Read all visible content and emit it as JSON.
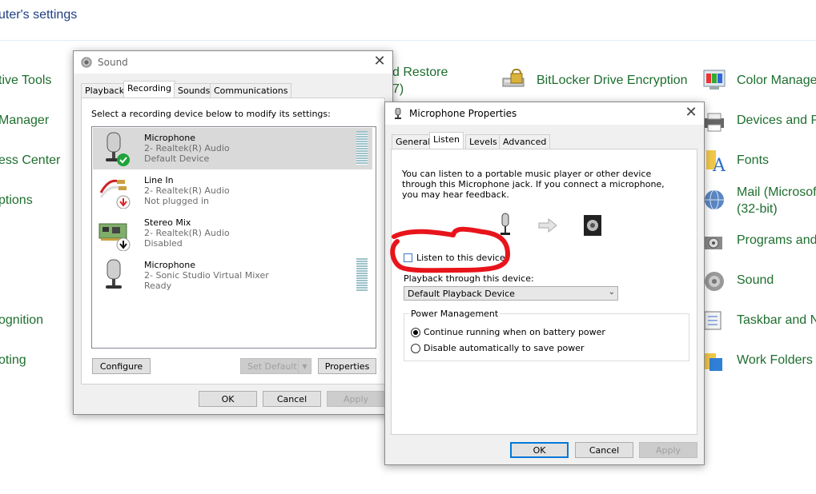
{
  "control_panel": {
    "heading": "uter's settings",
    "col1": [
      "tive Tools",
      "Manager",
      "ess Center",
      "ptions",
      "ognition",
      "oting"
    ],
    "col2": [
      "d Restore",
      "7)"
    ],
    "col3": [
      "BitLocker Drive Encryption"
    ],
    "col4": [
      "Color Manage",
      "Devices and Pr",
      "Fonts",
      "Mail (Microsof",
      "(32-bit)",
      "Programs and",
      "Sound",
      "Taskbar and N",
      "Work Folders"
    ]
  },
  "sound_dialog": {
    "title": "Sound",
    "tabs": [
      "Playback",
      "Recording",
      "Sounds",
      "Communications"
    ],
    "active_tab": "Recording",
    "instruction": "Select a recording device below to modify its settings:",
    "devices": [
      {
        "name": "Microphone",
        "driver": "2- Realtek(R) Audio",
        "status": "Default Device",
        "icon": "microphone-icon",
        "badge": "green-check"
      },
      {
        "name": "Line In",
        "driver": "2- Realtek(R) Audio",
        "status": "Not plugged in",
        "icon": "line-in-cable-icon",
        "badge": "red-down-arrow"
      },
      {
        "name": "Stereo Mix",
        "driver": "2- Realtek(R) Audio",
        "status": "Disabled",
        "icon": "sound-card-icon",
        "badge": "black-down-arrow"
      },
      {
        "name": "Microphone",
        "driver": "2- Sonic Studio Virtual Mixer",
        "status": "Ready",
        "icon": "microphone-icon",
        "badge": ""
      }
    ],
    "buttons": {
      "configure": "Configure",
      "set_default": "Set Default",
      "properties": "Properties",
      "ok": "OK",
      "cancel": "Cancel",
      "apply": "Apply"
    }
  },
  "mic_dialog": {
    "title": "Microphone Properties",
    "tabs": [
      "General",
      "Listen",
      "Levels",
      "Advanced"
    ],
    "active_tab": "Listen",
    "description": "You can listen to a portable music player or other device through this Microphone jack.  If you connect a microphone, you may hear feedback.",
    "listen_checkbox": {
      "label": "Listen to this device",
      "checked": false
    },
    "playback_label": "Playback through this device:",
    "playback_select": "Default Playback Device",
    "power_group": "Power Management",
    "power_options": [
      {
        "label": "Continue running when on battery power",
        "selected": true
      },
      {
        "label": "Disable automatically to save power",
        "selected": false
      }
    ],
    "buttons": {
      "ok": "OK",
      "cancel": "Cancel",
      "apply": "Apply"
    },
    "annotation_color": "#e8141b"
  }
}
